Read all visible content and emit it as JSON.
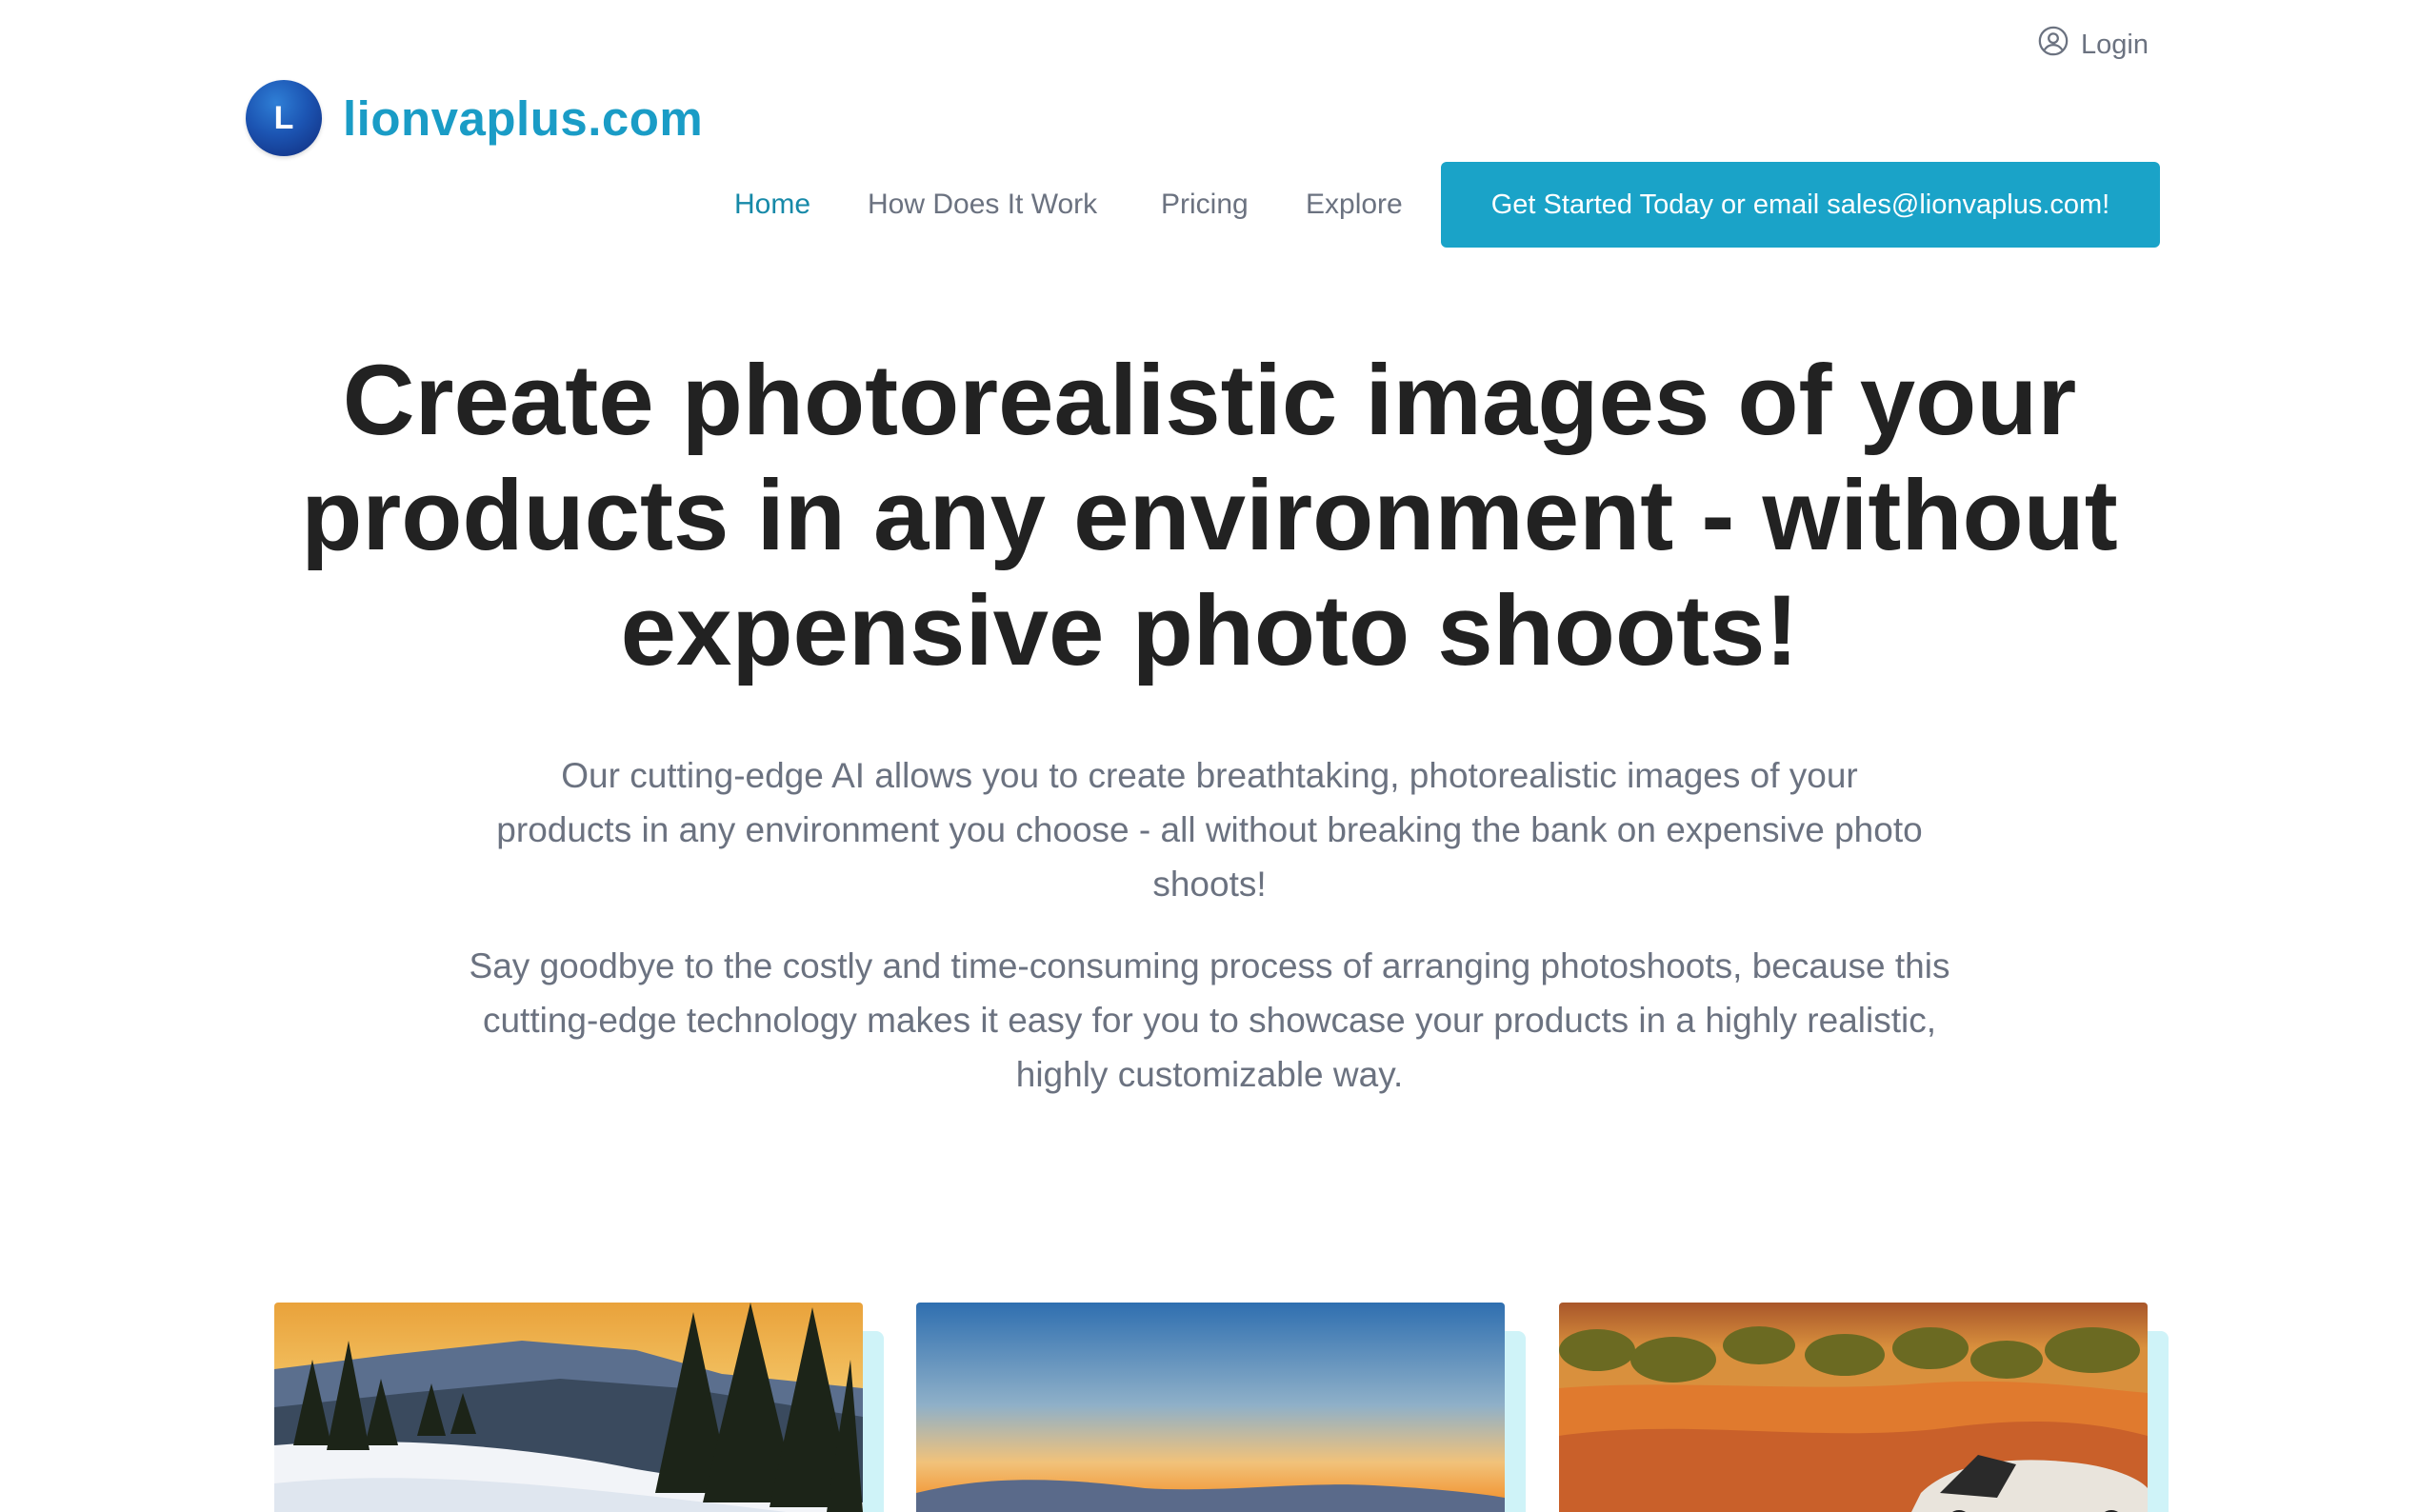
{
  "header": {
    "login_label": "Login",
    "logo_letter": "L",
    "site_name": "lionvaplus.com"
  },
  "nav": {
    "items": [
      {
        "label": "Home",
        "active": true
      },
      {
        "label": "How Does It Work",
        "active": false
      },
      {
        "label": "Pricing",
        "active": false
      },
      {
        "label": "Explore",
        "active": false
      }
    ],
    "cta_label": "Get Started Today or email sales@lionvaplus.com!"
  },
  "hero": {
    "title": "Create photorealistic images of your products in any environment - without expensive photo shoots!",
    "paragraph_1": "Our cutting-edge AI allows you to create breathtaking, photorealistic images of your products in any environment you choose - all without breaking the bank on expensive photo shoots!",
    "paragraph_2": "Say goodbye to the costly and time-consuming process of arranging photoshoots, because this cutting-edge technology makes it easy for you to showcase your products in a highly realistic, highly customizable way."
  },
  "gallery": {
    "cards": [
      {
        "subject": "snowy-mountain-forest-sunset"
      },
      {
        "subject": "lake-sunset-horizon"
      },
      {
        "subject": "desert-convertible-car"
      }
    ]
  },
  "colors": {
    "brand": "#1a9cc6",
    "cta_bg": "#1aa3c8",
    "nav_active": "#1689a8",
    "muted_text": "#6b7280",
    "heading": "#222222",
    "card_accent": "#cff3f8"
  }
}
